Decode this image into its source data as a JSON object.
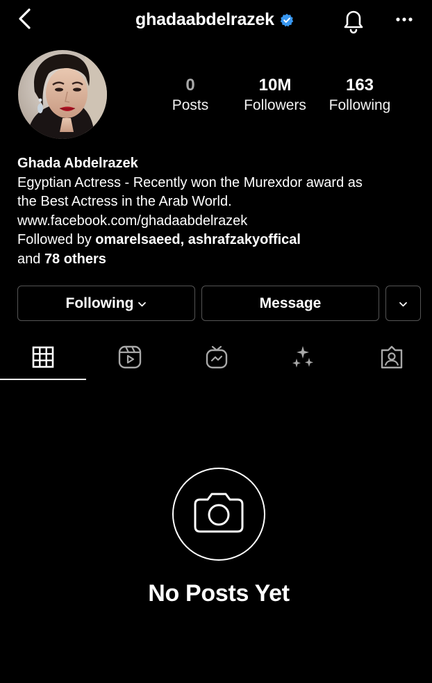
{
  "header": {
    "username": "ghadaabdelrazek",
    "verified_color": "#3897f0"
  },
  "profile": {
    "stats": [
      {
        "value": "0",
        "label": "Posts"
      },
      {
        "value": "10M",
        "label": "Followers"
      },
      {
        "value": "163",
        "label": "Following"
      }
    ],
    "name": "Ghada Abdelrazek",
    "bio_line1": "Egyptian Actress - Recently won the Murexdor award as",
    "bio_line2": "the Best Actress in the Arab World.",
    "website": "www.facebook.com/ghadaabdelrazek",
    "followed_by_prefix": "Followed by ",
    "followed_by_users": "omarelsaeed, ashrafzakyoffical",
    "followed_by_and": "and ",
    "followed_by_others": "78 others"
  },
  "actions": {
    "following_label": "Following",
    "message_label": "Message"
  },
  "tabs": [
    {
      "icon": "grid-icon",
      "active": true
    },
    {
      "icon": "reels-icon",
      "active": false
    },
    {
      "icon": "igtv-icon",
      "active": false
    },
    {
      "icon": "effects-icon",
      "active": false
    },
    {
      "icon": "tagged-icon",
      "active": false
    }
  ],
  "empty_state": {
    "title": "No Posts Yet",
    "icon": "camera-icon"
  }
}
